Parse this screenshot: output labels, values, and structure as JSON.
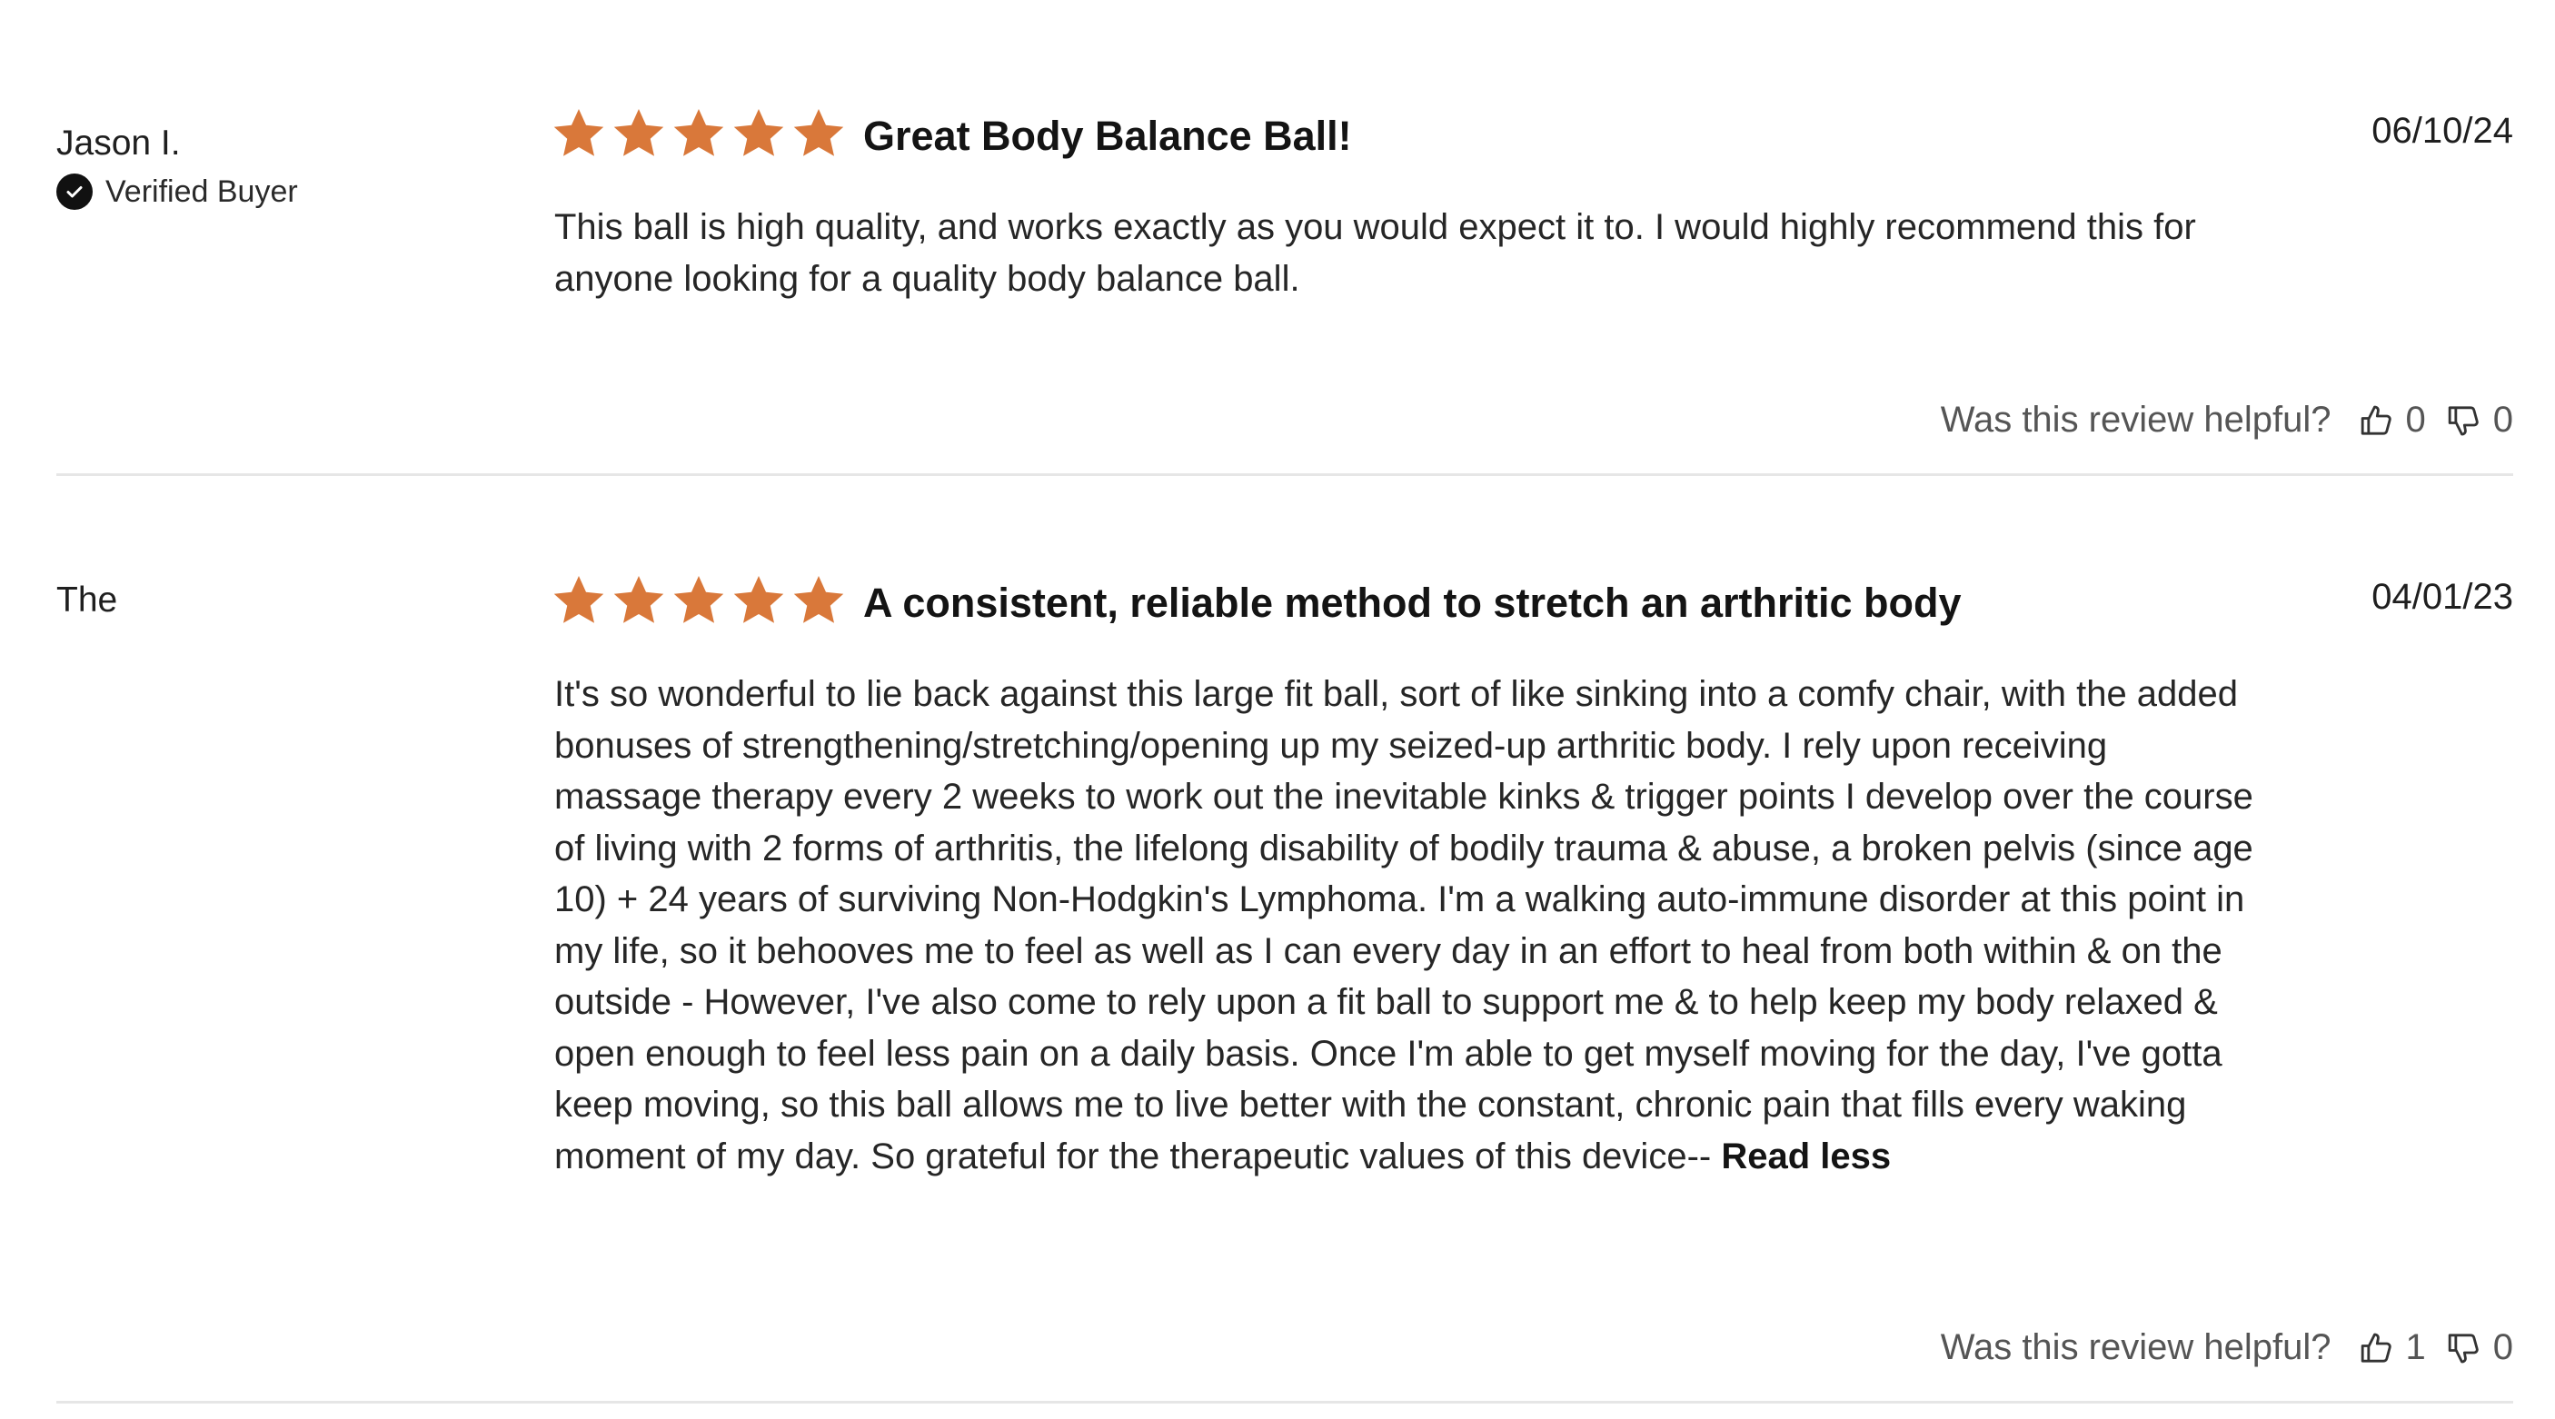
{
  "colors": {
    "star": "#D9783A",
    "divider": "#E6E6E6",
    "text": "#1F1F1F",
    "muted": "#555555"
  },
  "helpful_prompt": "Was this review helpful?",
  "reviews": [
    {
      "author": "Jason I.",
      "verified_label": "Verified Buyer",
      "rating": 5,
      "title": "Great Body Balance Ball!",
      "date": "06/10/24",
      "body": "This ball is high quality, and works exactly as you would expect it to. I would highly recommend this for anyone looking for a quality body balance ball.",
      "helpful_yes": "0",
      "helpful_no": "0"
    },
    {
      "author": "The",
      "rating": 5,
      "title": "A consistent, reliable method to stretch an arthritic body",
      "date": "04/01/23",
      "body": "It's so wonderful to lie back against this large fit ball, sort of like sinking into a comfy chair, with the added bonuses of strengthening/stretching/opening up my seized-up arthritic body. I rely upon receiving massage therapy every 2 weeks to work out the inevitable kinks & trigger points I develop over the course of living with 2 forms of arthritis, the lifelong disability of bodily trauma & abuse, a broken pelvis (since age 10) + 24 years of surviving Non-Hodgkin's Lymphoma. I'm a walking auto-immune disorder at this point in my life, so it behooves me to feel as well as I can every day in an effort to heal from both within & on the outside - However, I've also come to rely upon a fit ball to support me & to help keep my body relaxed & open enough to feel less pain on a daily basis. Once I'm able to get myself moving for the day, I've gotta keep moving, so this ball allows me to live better with the constant, chronic pain that fills every waking moment of my day. So grateful for the therapeutic values of this device-- ",
      "read_less_label": "Read less",
      "helpful_yes": "1",
      "helpful_no": "0"
    }
  ]
}
